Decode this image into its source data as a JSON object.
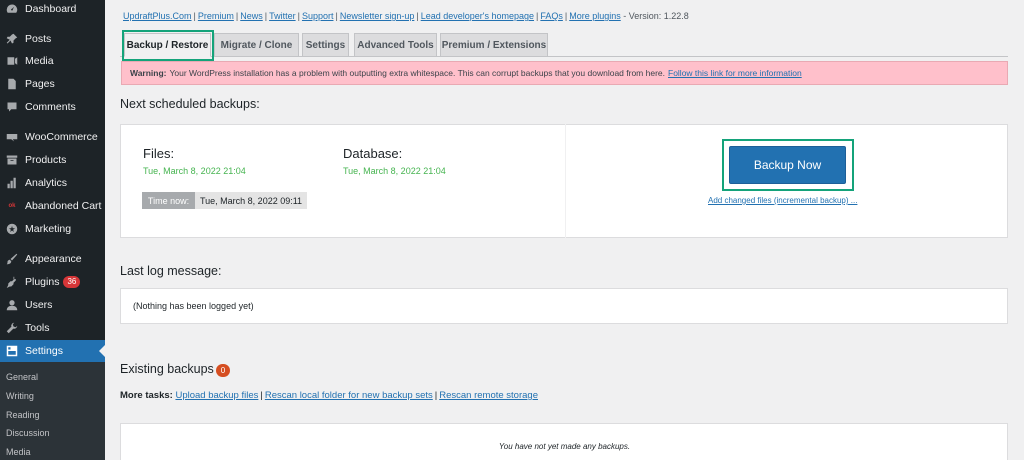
{
  "sidebar": {
    "items": [
      {
        "label": "Dashboard",
        "icon": "dashboard-icon"
      },
      {
        "label": "Posts",
        "icon": "pin-icon"
      },
      {
        "label": "Media",
        "icon": "media-icon"
      },
      {
        "label": "Pages",
        "icon": "page-icon"
      },
      {
        "label": "Comments",
        "icon": "comment-icon"
      },
      {
        "label": "WooCommerce",
        "icon": "woo-icon"
      },
      {
        "label": "Products",
        "icon": "archive-icon"
      },
      {
        "label": "Analytics",
        "icon": "chart-icon"
      },
      {
        "label": "Abandoned Cart",
        "icon": "cart-icon"
      },
      {
        "label": "Marketing",
        "icon": "megaphone-icon"
      },
      {
        "label": "Appearance",
        "icon": "brush-icon"
      },
      {
        "label": "Plugins",
        "icon": "plug-icon",
        "badge": "36"
      },
      {
        "label": "Users",
        "icon": "users-icon"
      },
      {
        "label": "Tools",
        "icon": "wrench-icon"
      },
      {
        "label": "Settings",
        "icon": "settings-icon",
        "active": true
      }
    ],
    "submenu": [
      "General",
      "Writing",
      "Reading",
      "Discussion",
      "Media"
    ]
  },
  "toplinks": {
    "links": [
      "UpdraftPlus.Com",
      "Premium",
      "News",
      "Twitter",
      "Support",
      "Newsletter sign-up",
      "Lead developer's homepage",
      "FAQs",
      "More plugins"
    ],
    "version": "- Version: 1.22.8"
  },
  "tabs": [
    "Backup / Restore",
    "Migrate / Clone",
    "Settings",
    "Advanced Tools",
    "Premium / Extensions"
  ],
  "warning": {
    "label": "Warning:",
    "text": "Your WordPress installation has a problem with outputting extra whitespace. This can corrupt backups that you download from here.",
    "link": "Follow this link for more information"
  },
  "scheduled": {
    "heading": "Next scheduled backups:",
    "files_label": "Files:",
    "files_date": "Tue, March 8, 2022 21:04",
    "db_label": "Database:",
    "db_date": "Tue, March 8, 2022 21:04",
    "time_now_label": "Time now:",
    "time_now_value": "Tue, March 8, 2022 09:11",
    "backup_now": "Backup Now",
    "incremental": "Add changed files (incremental backup) ..."
  },
  "log": {
    "heading": "Last log message:",
    "text": "(Nothing has been logged yet)"
  },
  "existing": {
    "heading": "Existing backups",
    "count": "0",
    "more_tasks_label": "More tasks:",
    "tasks": [
      "Upload backup files",
      "Rescan local folder for new backup sets",
      "Rescan remote storage"
    ],
    "empty_text": "You have not yet made any backups."
  },
  "colors": {
    "accent": "#2271b1",
    "highlight": "#14a37a",
    "warning_bg": "#ffc0cb",
    "success": "#46b450"
  }
}
